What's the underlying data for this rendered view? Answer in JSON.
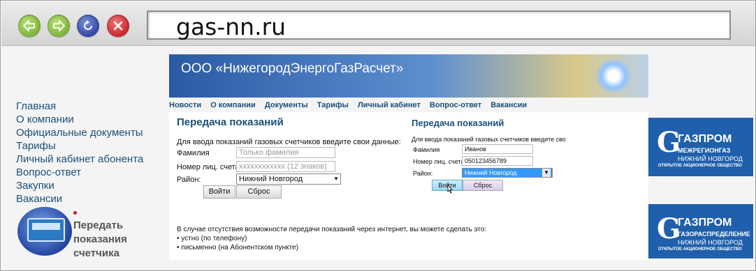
{
  "browser": {
    "url": "gas-nn.ru"
  },
  "sidebar": {
    "items": [
      {
        "label": "Главная"
      },
      {
        "label": "О компании"
      },
      {
        "label": "Официальные документы"
      },
      {
        "label": "Тарифы"
      },
      {
        "label": "Личный кабинет абонента"
      },
      {
        "label": "Вопрос-ответ"
      },
      {
        "label": "Закупки"
      },
      {
        "label": "Вакансии"
      }
    ],
    "meter_caption_1": "Передать",
    "meter_caption_2": "показания",
    "meter_caption_3": "счетчика"
  },
  "banner": {
    "title": "ООО «НижегородЭнергоГазРасчет»"
  },
  "topnav": {
    "items": [
      "Новости",
      "О компании",
      "Документы",
      "Тарифы",
      "Личный кабинет",
      "Вопрос-ответ",
      "Вакансии"
    ]
  },
  "form_left": {
    "heading": "Передача показаний",
    "intro": "Для ввода показаний газовых счетчиков введите свои данные:",
    "surname_label": "Фамилия",
    "surname_placeholder": "Только фамилия",
    "account_label": "Номер лиц. счета",
    "account_placeholder": "xxxxxxxxxxxx (12 знаков)",
    "district_label": "Район:",
    "district_value": "Нижний Новгород",
    "submit": "Войти",
    "reset": "Сброс"
  },
  "form_right": {
    "heading": "Передача показаний",
    "intro": "Для ввода показаний газовых счетчиков введите сво",
    "surname_label": "Фамилия",
    "surname_value": "Иванов",
    "account_label": "Номер лиц. счета",
    "account_value": "050123456789",
    "district_label": "Район:",
    "district_value": "Нижний Новгород",
    "submit": "Войти",
    "reset": "Сброс"
  },
  "note": {
    "text": "В случае отсутствия возможности передачи показаний через интернет, вы можете сделать это:",
    "items": [
      "устно (по телефону)",
      "письменно (на Абонентском пункте)"
    ]
  },
  "logos": {
    "top": {
      "big": "ГАЗПРОМ",
      "line1": "МЕЖРЕГИОНГАЗ",
      "line2": "НИЖНИЙ НОВГОРОД",
      "line3": "ОТКРЫТОЕ АКЦИОНЕРНОЕ ОБЩЕСТВО"
    },
    "bottom": {
      "big": "ГАЗПРОМ",
      "line1": "ГАЗОРАСПРЕДЕЛЕНИЕ",
      "line2": "НИЖНИЙ НОВГОРОД",
      "line3": "ОТКРЫТОЕ АКЦИОНЕРНОЕ ОБЩЕСТВО"
    }
  },
  "colors": {
    "link": "#1a4f78",
    "brand_blue": "#1f5fab",
    "selected_option": "#3399ff"
  }
}
